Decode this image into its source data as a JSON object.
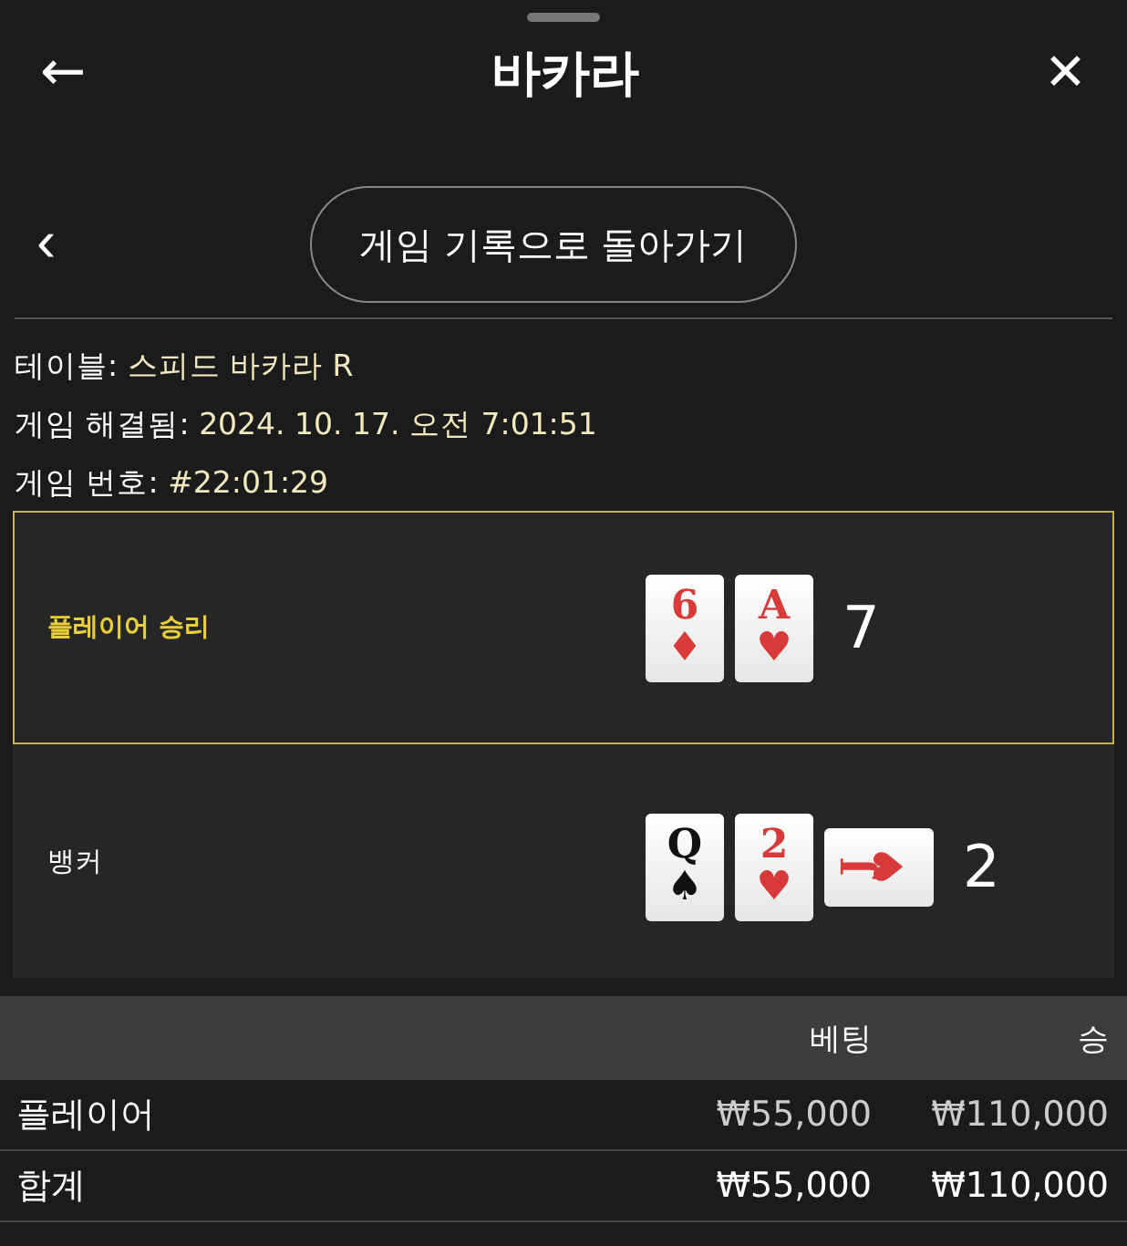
{
  "header": {
    "back_icon": "←",
    "title": "바카라",
    "close_icon": "✕"
  },
  "nav": {
    "prev_icon": "‹",
    "button": "게임 기록으로 돌아가기"
  },
  "info": [
    {
      "label": "테이블:",
      "value": "스피드 바카라 R"
    },
    {
      "label": "게임 해결됨:",
      "value": "2024. 10. 17. 오전 7:01:51"
    },
    {
      "label": "게임 번호:",
      "value": "#22:01:29"
    }
  ],
  "hands": [
    {
      "name": "플레이어 승리",
      "winner": true,
      "total": "7",
      "cards": [
        {
          "rank": "6",
          "suit": "♦",
          "color": "#d83a3a",
          "kind": "upright"
        },
        {
          "rank": "A",
          "suit": "♥",
          "color": "#d83a3a",
          "kind": "upright"
        }
      ]
    },
    {
      "name": "뱅커",
      "winner": false,
      "total": "2",
      "cards": [
        {
          "rank": "Q",
          "suit": "♠",
          "color": "#111111",
          "kind": "upright"
        },
        {
          "rank": "2",
          "suit": "♥",
          "color": "#d83a3a",
          "kind": "upright"
        },
        {
          "rank": "J",
          "suit": "♥",
          "color": "#d83a3a",
          "kind": "sideways"
        }
      ]
    }
  ],
  "table": {
    "columns": [
      "베팅",
      "승"
    ],
    "rows": [
      {
        "kind": "bet",
        "label": "플레이어",
        "bet": "₩55,000",
        "win": "₩110,000"
      },
      {
        "kind": "total",
        "label": "합계",
        "bet": "₩55,000",
        "win": "₩110,000"
      }
    ]
  }
}
